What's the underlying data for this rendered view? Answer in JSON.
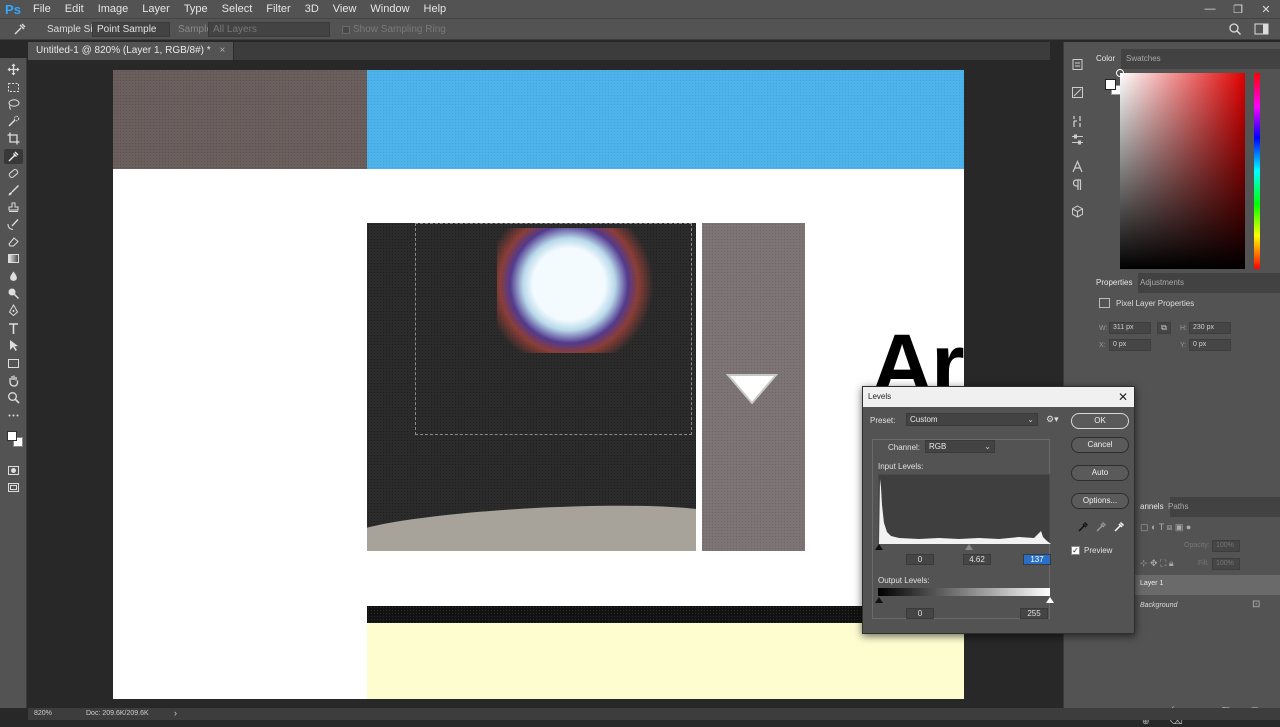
{
  "menubar": {
    "logo": "Ps",
    "items": [
      "File",
      "Edit",
      "Image",
      "Layer",
      "Type",
      "Select",
      "Filter",
      "3D",
      "View",
      "Window",
      "Help"
    ],
    "minimize": "—",
    "restore": "❐",
    "close": "✕"
  },
  "options": {
    "sample_size_label": "Sample Size:",
    "sample_size_value": "Point Sample",
    "sample_label": "Sample:",
    "sample_value": "All Layers",
    "sampling_ring_label": "Show Sampling Ring"
  },
  "document": {
    "tab_title": "Untitled-1 @ 820% (Layer 1, RGB/8#) *",
    "tab_close": "×",
    "canvas_text": "Ar"
  },
  "status": {
    "zoom": "820%",
    "doc_size": "Doc: 209.6K/209.6K",
    "arrow": "›"
  },
  "panels": {
    "color_tabs": [
      "Color",
      "Swatches"
    ],
    "properties_tabs": [
      "Properties",
      "Adjustments"
    ],
    "pixel_layer_title": "Pixel Layer Properties",
    "w_label": "W:",
    "w_value": "311 px",
    "h_label": "H:",
    "h_value": "230 px",
    "x_label": "X:",
    "x_value": "0 px",
    "y_label": "Y:",
    "y_value": "0 px",
    "layers_tabs": [
      "annels",
      "Paths"
    ],
    "opacity_label": "Opacity:",
    "opacity_value": "100%",
    "fill_label": "Fill:",
    "fill_value": "100%",
    "layers": [
      "Layer 1",
      "Background"
    ]
  },
  "levels": {
    "title": "Levels",
    "close": "✕",
    "preset_label": "Preset:",
    "preset_value": "Custom",
    "channel_label": "Channel:",
    "channel_value": "RGB",
    "input_label": "Input Levels:",
    "input_black": "0",
    "input_gamma": "4.62",
    "input_white": "137",
    "output_label": "Output Levels:",
    "output_black": "0",
    "output_white": "255",
    "ok": "OK",
    "cancel": "Cancel",
    "auto": "Auto",
    "options": "Options...",
    "preview_label": "Preview",
    "preview_checked": true
  },
  "colors": {
    "accent": "#31a8ff",
    "canvas_blue": "#4db3ea",
    "canvas_brown": "#6b5f5e",
    "canvas_yellow": "#fefdd0",
    "canvas_gray": "#7d7575"
  }
}
